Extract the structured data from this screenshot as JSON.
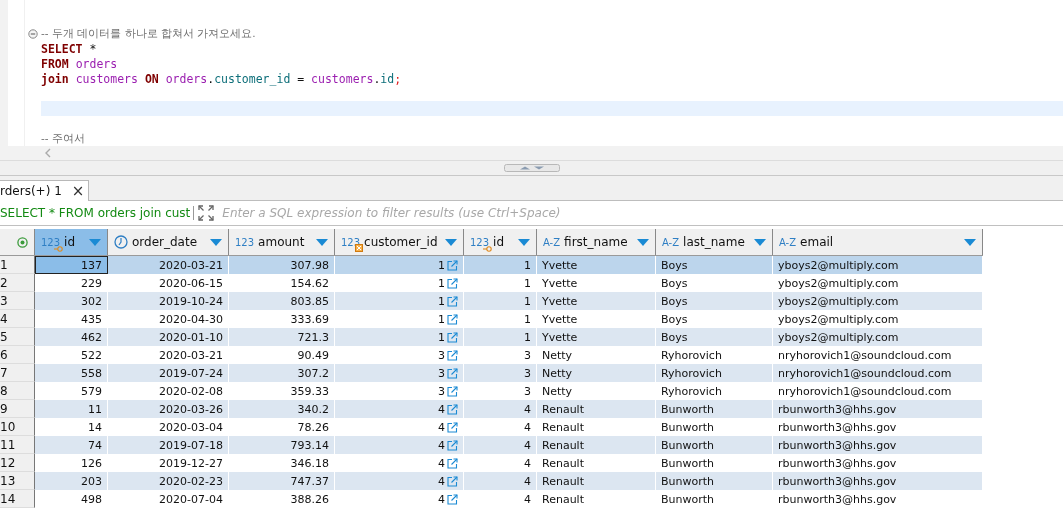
{
  "editor": {
    "lines": [
      {
        "fold": true,
        "current": false,
        "tokens": [
          {
            "text": "-- 두개 데이터를 하나로 합쳐서 가져오세요.",
            "kind": "comment"
          }
        ]
      },
      {
        "fold": false,
        "current": false,
        "tokens": [
          {
            "text": "SELECT",
            "kind": "keyword"
          },
          {
            "text": " *",
            "kind": "plain"
          }
        ]
      },
      {
        "fold": false,
        "current": false,
        "tokens": [
          {
            "text": "FROM",
            "kind": "keyword"
          },
          {
            "text": " orders",
            "kind": "table"
          }
        ]
      },
      {
        "fold": false,
        "current": false,
        "tokens": [
          {
            "text": "join",
            "kind": "keyword"
          },
          {
            "text": " customers ",
            "kind": "table"
          },
          {
            "text": "ON",
            "kind": "keyword"
          },
          {
            "text": " orders",
            "kind": "table"
          },
          {
            "text": ".",
            "kind": "plain"
          },
          {
            "text": "customer_id",
            "kind": "column"
          },
          {
            "text": " = ",
            "kind": "plain"
          },
          {
            "text": "customers",
            "kind": "table"
          },
          {
            "text": ".",
            "kind": "plain"
          },
          {
            "text": "id",
            "kind": "column"
          },
          {
            "text": ";",
            "kind": "semi"
          }
        ]
      },
      {
        "fold": false,
        "current": true
      },
      {
        "fold": false,
        "current": false,
        "tokens": [
          {
            "text": "-- 주여서",
            "kind": "comment"
          }
        ]
      }
    ]
  },
  "result_tab": {
    "label": "rders(+) 1",
    "close": "×"
  },
  "filter": {
    "query": "SELECT * FROM orders join cust",
    "placeholder": "Enter a SQL expression to filter results (use Ctrl+Space)"
  },
  "table": {
    "columns": [
      {
        "name": "id",
        "icon_text": "123",
        "kind": "number",
        "primary_key": true,
        "sorted": true
      },
      {
        "name": "order_date",
        "kind": "date",
        "sorted": false
      },
      {
        "name": "amount",
        "icon_text": "123",
        "kind": "number",
        "sorted": false
      },
      {
        "name": "customer_id",
        "icon_text": "123",
        "kind": "number",
        "foreign_key": true,
        "sorted": false
      },
      {
        "name": "id",
        "icon_text": "123",
        "kind": "number",
        "primary_key": true,
        "sorted": false
      },
      {
        "name": "first_name",
        "icon_text": "A-Z",
        "kind": "text",
        "sorted": false
      },
      {
        "name": "last_name",
        "icon_text": "A-Z",
        "kind": "text",
        "sorted": false
      },
      {
        "name": "email",
        "icon_text": "A-Z",
        "kind": "text",
        "sorted": false
      }
    ],
    "rows": [
      {
        "number": "1",
        "selected": true,
        "cells": [
          "137",
          "2020-03-21",
          "307.98",
          "1",
          "1",
          "Yvette",
          "Boys",
          "yboys2@multiply.com"
        ]
      },
      {
        "number": "2",
        "selected": false,
        "cells": [
          "229",
          "2020-06-15",
          "154.62",
          "1",
          "1",
          "Yvette",
          "Boys",
          "yboys2@multiply.com"
        ]
      },
      {
        "number": "3",
        "selected": false,
        "cells": [
          "302",
          "2019-10-24",
          "803.85",
          "1",
          "1",
          "Yvette",
          "Boys",
          "yboys2@multiply.com"
        ]
      },
      {
        "number": "4",
        "selected": false,
        "cells": [
          "435",
          "2020-04-30",
          "333.69",
          "1",
          "1",
          "Yvette",
          "Boys",
          "yboys2@multiply.com"
        ]
      },
      {
        "number": "5",
        "selected": false,
        "cells": [
          "462",
          "2020-01-10",
          "721.3",
          "1",
          "1",
          "Yvette",
          "Boys",
          "yboys2@multiply.com"
        ]
      },
      {
        "number": "6",
        "selected": false,
        "cells": [
          "522",
          "2020-03-21",
          "90.49",
          "3",
          "3",
          "Netty",
          "Ryhorovich",
          "nryhorovich1@soundcloud.com"
        ]
      },
      {
        "number": "7",
        "selected": false,
        "cells": [
          "558",
          "2019-07-24",
          "307.2",
          "3",
          "3",
          "Netty",
          "Ryhorovich",
          "nryhorovich1@soundcloud.com"
        ]
      },
      {
        "number": "8",
        "selected": false,
        "cells": [
          "579",
          "2020-02-08",
          "359.33",
          "3",
          "3",
          "Netty",
          "Ryhorovich",
          "nryhorovich1@soundcloud.com"
        ]
      },
      {
        "number": "9",
        "selected": false,
        "cells": [
          "11",
          "2020-03-26",
          "340.2",
          "4",
          "4",
          "Renault",
          "Bunworth",
          "rbunworth3@hhs.gov"
        ]
      },
      {
        "number": "10",
        "selected": false,
        "cells": [
          "14",
          "2020-03-04",
          "78.26",
          "4",
          "4",
          "Renault",
          "Bunworth",
          "rbunworth3@hhs.gov"
        ]
      },
      {
        "number": "11",
        "selected": false,
        "cells": [
          "74",
          "2019-07-18",
          "793.14",
          "4",
          "4",
          "Renault",
          "Bunworth",
          "rbunworth3@hhs.gov"
        ]
      },
      {
        "number": "12",
        "selected": false,
        "cells": [
          "126",
          "2019-12-27",
          "346.18",
          "4",
          "4",
          "Renault",
          "Bunworth",
          "rbunworth3@hhs.gov"
        ]
      },
      {
        "number": "13",
        "selected": false,
        "cells": [
          "203",
          "2020-02-23",
          "747.37",
          "4",
          "4",
          "Renault",
          "Bunworth",
          "rbunworth3@hhs.gov"
        ]
      },
      {
        "number": "14",
        "selected": false,
        "cells": [
          "498",
          "2020-07-04",
          "388.26",
          "4",
          "4",
          "Renault",
          "Bunworth",
          "rbunworth3@hhs.gov"
        ]
      }
    ]
  }
}
